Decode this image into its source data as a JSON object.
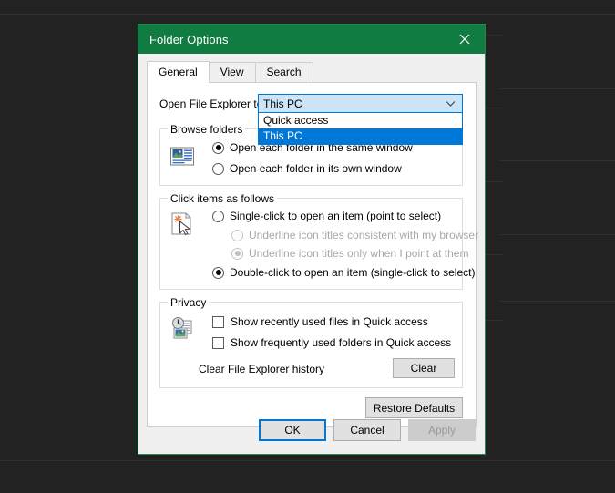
{
  "window": {
    "title": "Folder Options",
    "close_icon": "close-icon",
    "titlebar_color": "#107c41"
  },
  "tabs": [
    {
      "label": "General",
      "active": true
    },
    {
      "label": "View",
      "active": false
    },
    {
      "label": "Search",
      "active": false
    }
  ],
  "general": {
    "combo": {
      "label": "Open File Explorer to:",
      "value": "This PC",
      "arrow_icon": "chevron-down-icon",
      "expanded": true,
      "options": [
        {
          "label": "Quick access",
          "selected": false
        },
        {
          "label": "This PC",
          "selected": true
        }
      ]
    },
    "browse_folders": {
      "title": "Browse folders",
      "icon": "folder-window-icon",
      "options": [
        {
          "label": "Open each folder in the same window",
          "checked": true,
          "disabled": false
        },
        {
          "label": "Open each folder in its own window",
          "checked": false,
          "disabled": false
        }
      ]
    },
    "click_items": {
      "title": "Click items as follows",
      "icon": "document-cursor-icon",
      "options": [
        {
          "label": "Single-click to open an item (point to select)",
          "checked": false,
          "disabled": false
        },
        {
          "label": "Underline icon titles consistent with my browser",
          "checked": false,
          "disabled": true
        },
        {
          "label": "Underline icon titles only when I point at them",
          "checked": true,
          "disabled": true
        },
        {
          "label": "Double-click to open an item (single-click to select)",
          "checked": true,
          "disabled": false
        }
      ]
    },
    "privacy": {
      "title": "Privacy",
      "icon": "clock-documents-icon",
      "checkboxes": [
        {
          "label": "Show recently used files in Quick access",
          "checked": false
        },
        {
          "label": "Show frequently used folders in Quick access",
          "checked": false
        }
      ],
      "clear_history_label": "Clear File Explorer history",
      "clear_button": "Clear"
    },
    "restore_defaults": "Restore Defaults"
  },
  "footer": {
    "ok": "OK",
    "cancel": "Cancel",
    "apply": "Apply"
  },
  "colors": {
    "accent_green": "#107c41",
    "focus_blue": "#0078d7",
    "selection_blue": "#0078d7",
    "combo_fill": "#cce4f7",
    "backdrop": "#222222"
  }
}
